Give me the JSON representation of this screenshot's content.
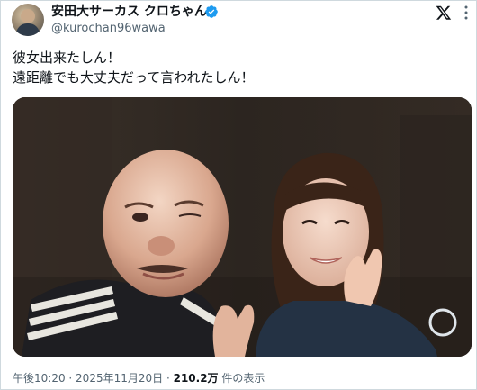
{
  "author": {
    "display_name": "安田大サーカス クロちゃん",
    "handle": "@kurochan96wawa",
    "verified": true
  },
  "tweet": {
    "line1": "彼女出来たしん！",
    "line2": "遠距離でも大丈夫だって言われたしん！"
  },
  "meta": {
    "time": "午後10:20",
    "separator1": " · ",
    "date": "2025年11月20日",
    "separator2": " · ",
    "views": "210.2万",
    "views_label": " 件の表示"
  },
  "colors": {
    "verified": "#1d9bf0",
    "secondary_text": "#536471",
    "border": "#cfd9de"
  },
  "icons": [
    "verified-badge-icon",
    "x-logo-icon",
    "more-icon"
  ]
}
